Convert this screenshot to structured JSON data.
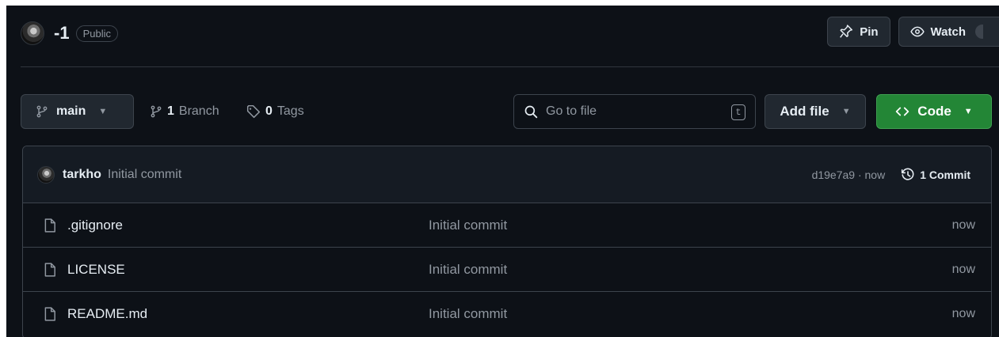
{
  "repo": {
    "name": "-1",
    "visibility": "Public"
  },
  "header_actions": {
    "pin_label": "Pin",
    "watch_label": "Watch"
  },
  "toolbar": {
    "branch": "main",
    "branches_count": "1",
    "branches_label": "Branch",
    "tags_count": "0",
    "tags_label": "Tags",
    "search_placeholder": "Go to file",
    "search_shortcut": "t",
    "add_file_label": "Add file",
    "code_label": "Code"
  },
  "latest_commit": {
    "author": "tarkho",
    "message": "Initial commit",
    "sha_time": "d19e7a9 · now",
    "commits_label": "1 Commit"
  },
  "files": [
    {
      "name": ".gitignore",
      "message": "Initial commit",
      "date": "now"
    },
    {
      "name": "LICENSE",
      "message": "Initial commit",
      "date": "now"
    },
    {
      "name": "README.md",
      "message": "Initial commit",
      "date": "now"
    }
  ],
  "colors": {
    "background": "#0d1117",
    "border": "#3d444d",
    "code_button": "#238636",
    "muted_text": "#9198a1"
  },
  "icons": [
    "pin-icon",
    "eye-icon",
    "branch-icon",
    "tag-icon",
    "search-icon",
    "code-icon",
    "history-icon",
    "file-icon",
    "chevron-down-icon"
  ]
}
